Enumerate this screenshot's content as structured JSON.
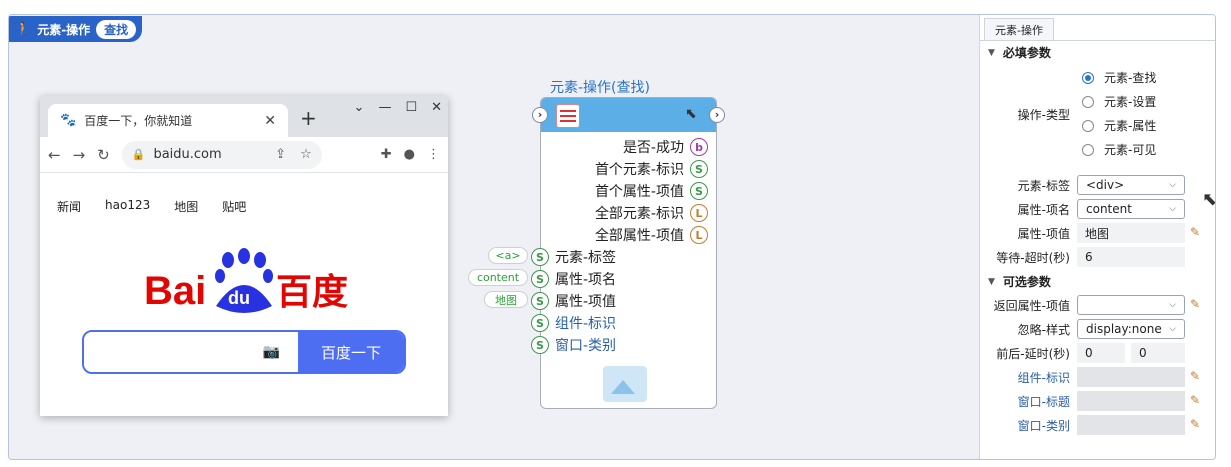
{
  "canvas": {
    "title": "元素-操作",
    "title_tag": "查找"
  },
  "browser": {
    "tab_title": "百度一下，你就知道",
    "address": "baidu.com",
    "nav_links": [
      "新闻",
      "hao123",
      "地图",
      "贴吧"
    ],
    "logo_text_left": "Bai",
    "logo_text_paw": "du",
    "logo_text_right": "百度",
    "search_button": "百度一下"
  },
  "node": {
    "title": "元素-操作(查找)",
    "outputs": [
      {
        "label": "是否-成功",
        "type": "b"
      },
      {
        "label": "首个元素-标识",
        "type": "S"
      },
      {
        "label": "首个属性-项值",
        "type": "S"
      },
      {
        "label": "全部元素-标识",
        "type": "L"
      },
      {
        "label": "全部属性-项值",
        "type": "L"
      }
    ],
    "inputs": [
      {
        "label": "元素-标签",
        "chip": "<a>"
      },
      {
        "label": "属性-项名",
        "chip": "content"
      },
      {
        "label": "属性-项值",
        "chip": "地图"
      },
      {
        "label": "组件-标识",
        "chip": ""
      },
      {
        "label": "窗口-类别",
        "chip": ""
      }
    ]
  },
  "panel": {
    "tab": "元素-操作",
    "required_section": "必填参数",
    "optional_section": "可选参数",
    "op_type_label": "操作-类型",
    "op_types": [
      "元素-查找",
      "元素-设置",
      "元素-属性",
      "元素-可见"
    ],
    "op_type_selected": 0,
    "element_tag_label": "元素-标签",
    "element_tag_value": "<div>",
    "attr_name_label": "属性-项名",
    "attr_name_value": "content",
    "attr_value_label": "属性-项值",
    "attr_value_value": "地图",
    "timeout_label": "等待-超时(秒)",
    "timeout_value": "6",
    "return_attr_label": "返回属性-项值",
    "return_attr_value": "",
    "ignore_style_label": "忽略-样式",
    "ignore_style_value": "display:none",
    "delay_label": "前后-延时(秒)",
    "delay_before": "0",
    "delay_after": "0",
    "component_id_label": "组件-标识",
    "window_title_label": "窗口-标题",
    "window_class_label": "窗口-类别"
  }
}
